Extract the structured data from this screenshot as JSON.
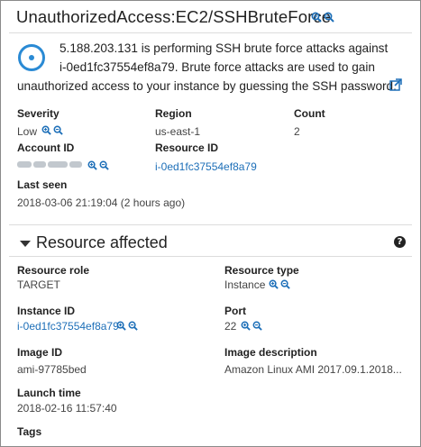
{
  "finding": {
    "title": "UnauthorizedAccess:EC2/SSHBruteForce",
    "description_line1": "5.188.203.131 is performing SSH brute force attacks against",
    "description_line2": "i-0ed1fc37554ef8a79. Brute force attacks are used to gain",
    "description_line3": "unauthorized access to your instance by guessing the SSH password."
  },
  "fields": {
    "severity_label": "Severity",
    "severity_value": "Low",
    "region_label": "Region",
    "region_value": "us-east-1",
    "count_label": "Count",
    "count_value": "2",
    "account_label": "Account ID",
    "resource_id_label": "Resource ID",
    "resource_id_value": "i-0ed1fc37554ef8a79",
    "last_seen_label": "Last seen",
    "last_seen_value": "2018-03-06 21:19:04 (2 hours ago)"
  },
  "resource": {
    "section_title": "Resource affected",
    "role_label": "Resource role",
    "role_value": "TARGET",
    "type_label": "Resource type",
    "type_value": "Instance",
    "instance_id_label": "Instance ID",
    "instance_id_value": "i-0ed1fc37554ef8a79",
    "port_label": "Port",
    "port_value": "22",
    "image_id_label": "Image ID",
    "image_id_value": "ami-97785bed",
    "image_desc_label": "Image description",
    "image_desc_value": "Amazon Linux AMI 2017.09.1.2018...",
    "launch_label": "Launch time",
    "launch_value": "2018-02-16 11:57:40",
    "tags_label": "Tags"
  },
  "icons": {
    "zoom_in": "zoom-in-icon",
    "zoom_out": "zoom-out-icon",
    "external_link": "external-link-icon",
    "help": "help-icon",
    "status": "status-circle-icon",
    "caret": "caret-down-icon"
  },
  "colors": {
    "link": "#1d6fb8",
    "accent": "#2a8ad4"
  }
}
